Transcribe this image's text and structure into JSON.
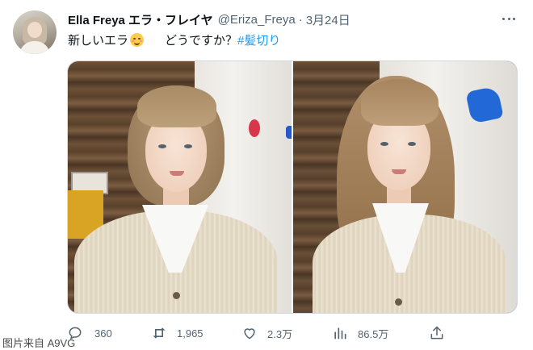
{
  "tweet": {
    "display_name": "Ella Freya エラ・フレイヤ",
    "handle": "@Eriza_Freya",
    "separator": "·",
    "date": "3月24日",
    "text_prefix": "新しいエラ",
    "emoji": "smiling-face-with-smiling-eyes-emoji",
    "text_body": "どうですか？",
    "hashtag": "#髪切り"
  },
  "media": {
    "photos": [
      "photo-before-haircut",
      "photo-after-haircut"
    ]
  },
  "actions": {
    "reply_count": "360",
    "retweet_count": "1,965",
    "like_count": "2.3万",
    "views_count": "86.5万"
  },
  "icons": {
    "reply": "reply-icon",
    "retweet": "retweet-icon",
    "like": "heart-icon",
    "views": "analytics-icon",
    "share": "share-icon",
    "more": "more-icon"
  },
  "colors": {
    "link": "#1d9bf0",
    "muted": "#536471",
    "text": "#0f1419"
  },
  "watermark": "图片来自 A9VG"
}
